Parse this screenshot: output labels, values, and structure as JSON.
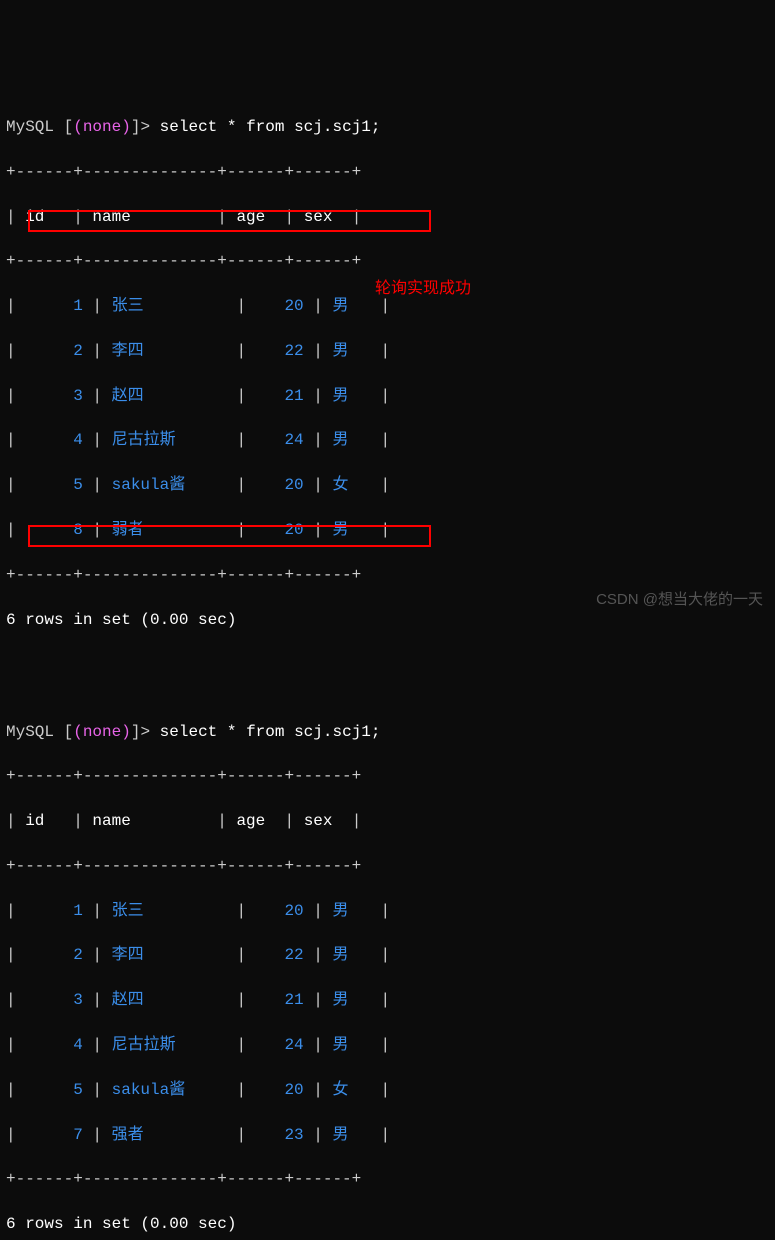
{
  "prompt": {
    "mysql": "MySQL",
    "db": "(none)",
    "gt": ">",
    "command": "select * from scj.scj1;"
  },
  "border": "+------+--------------+------+------+",
  "header": {
    "id": "id",
    "name": "name",
    "age": "age",
    "sex": "sex"
  },
  "query1": {
    "rows": [
      {
        "id": "1",
        "name": "张三",
        "age": "20",
        "sex": "男"
      },
      {
        "id": "2",
        "name": "李四",
        "age": "22",
        "sex": "男"
      },
      {
        "id": "3",
        "name": "赵四",
        "age": "21",
        "sex": "男"
      },
      {
        "id": "4",
        "name": "尼古拉斯",
        "age": "24",
        "sex": "男"
      },
      {
        "id": "5",
        "name": "sakula酱",
        "age": "20",
        "sex": "女"
      },
      {
        "id": "8",
        "name": "弱者",
        "age": "20",
        "sex": "男"
      }
    ],
    "result": "6 rows in set (0.00 sec)"
  },
  "query2": {
    "rows": [
      {
        "id": "1",
        "name": "张三",
        "age": "20",
        "sex": "男"
      },
      {
        "id": "2",
        "name": "李四",
        "age": "22",
        "sex": "男"
      },
      {
        "id": "3",
        "name": "赵四",
        "age": "21",
        "sex": "男"
      },
      {
        "id": "4",
        "name": "尼古拉斯",
        "age": "24",
        "sex": "男"
      },
      {
        "id": "5",
        "name": "sakula酱",
        "age": "20",
        "sex": "女"
      },
      {
        "id": "7",
        "name": "强者",
        "age": "23",
        "sex": "男"
      }
    ],
    "result": "6 rows in set (0.00 sec)"
  },
  "annotation": "轮询实现成功",
  "watermark": "CSDN @想当大佬的一天"
}
